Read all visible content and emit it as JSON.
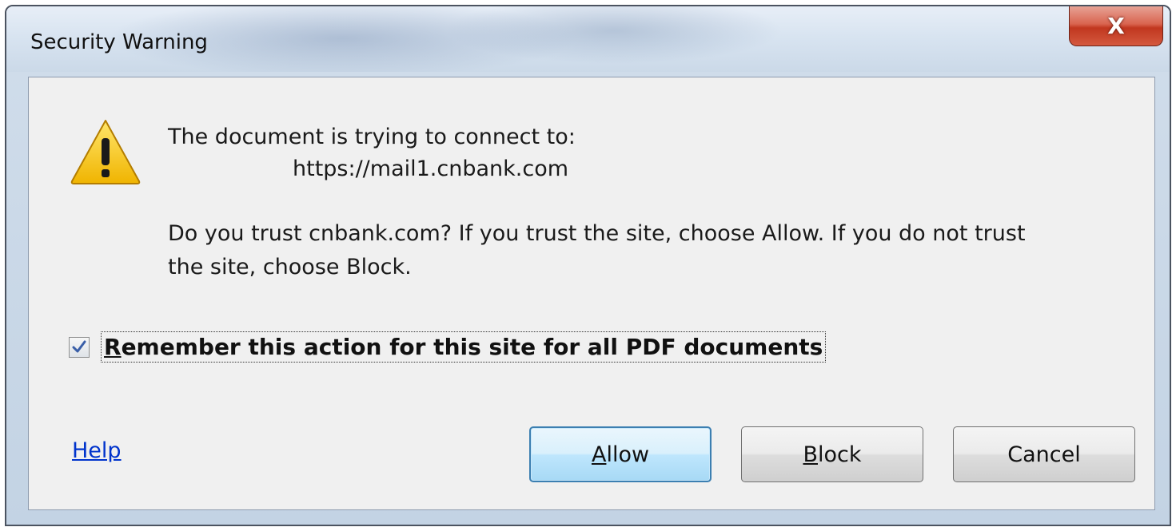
{
  "window": {
    "title": "Security Warning",
    "close_label": "X"
  },
  "message": {
    "connect_line": "The document is trying to connect to:",
    "url": "https://mail1.cnbank.com",
    "trust_line1": "Do you trust cnbank.com? If you trust the site, choose Allow. If you do not trust",
    "trust_line2": "the site, choose Block."
  },
  "remember": {
    "checked": true,
    "mnemonic": "R",
    "label_rest": "emember this action for this site for all PDF documents"
  },
  "help": {
    "label": "Help"
  },
  "buttons": {
    "allow": {
      "mnemonic": "A",
      "rest": "llow"
    },
    "block": {
      "mnemonic": "B",
      "rest": "lock"
    },
    "cancel": {
      "label": "Cancel"
    }
  },
  "icons": {
    "warning": "warning-triangle-icon",
    "close": "close-icon",
    "checkmark": "checkmark-icon"
  },
  "colors": {
    "accent": "#3c7fb1",
    "link": "#0033cc",
    "close_red": "#c1371f",
    "warning_yellow": "#f5c400"
  }
}
